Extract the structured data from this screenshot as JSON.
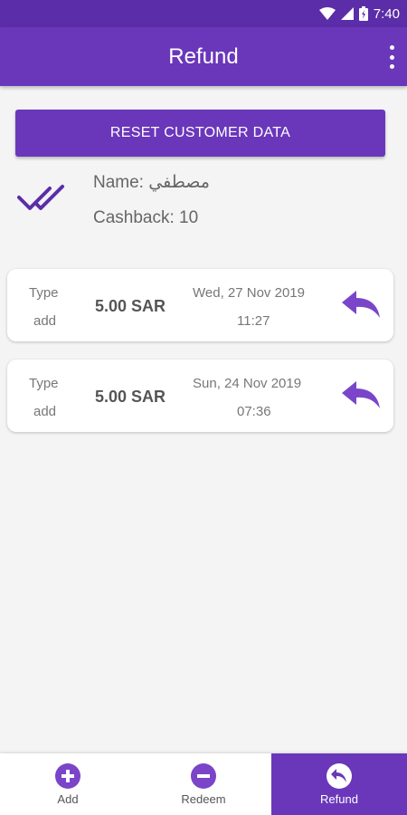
{
  "status_bar": {
    "time": "7:40"
  },
  "app_bar": {
    "title": "Refund"
  },
  "reset_button": {
    "label": "RESET CUSTOMER DATA"
  },
  "customer": {
    "name_line": "Name: مصطفي",
    "cashback_line": "Cashback: 10"
  },
  "transactions": [
    {
      "type_label": "Type",
      "type_value": "add",
      "amount": "5.00 SAR",
      "date": "Wed, 27 Nov 2019",
      "time": "11:27"
    },
    {
      "type_label": "Type",
      "type_value": "add",
      "amount": "5.00 SAR",
      "date": "Sun, 24 Nov 2019",
      "time": "07:36"
    }
  ],
  "bottom_nav": {
    "items": [
      {
        "label": "Add",
        "icon": "plus-circle-icon"
      },
      {
        "label": "Redeem",
        "icon": "minus-circle-icon"
      },
      {
        "label": "Refund",
        "icon": "undo-circle-icon",
        "active": true
      }
    ]
  },
  "colors": {
    "primary": "#6a37bb",
    "primary_dark": "#5b2da8",
    "background": "#f4f4f4"
  }
}
